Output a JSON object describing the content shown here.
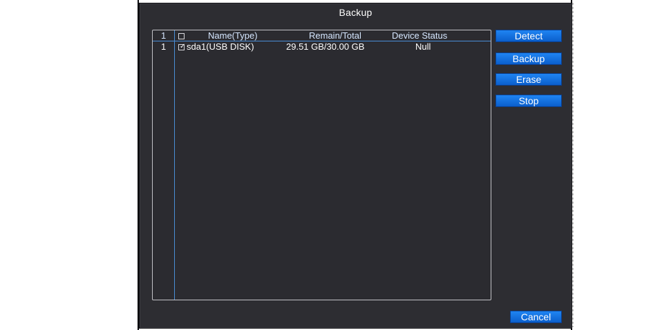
{
  "dialog": {
    "title": "Backup"
  },
  "table": {
    "header": {
      "index": "1",
      "name": "Name(Type)",
      "remain_total": "Remain/Total",
      "device_status": "Device Status"
    },
    "rows": [
      {
        "index": "1",
        "checked": true,
        "name": "sda1(USB DISK)",
        "remain_total": "29.51 GB/30.00 GB",
        "device_status": "Null"
      }
    ]
  },
  "buttons": {
    "detect": "Detect",
    "backup": "Backup",
    "erase": "Erase",
    "stop": "Stop",
    "cancel": "Cancel"
  },
  "colors": {
    "dialog_bg": "#2d2d32",
    "grid_line": "#4a8fd8",
    "button": "#0b5fcc",
    "text": "#ffffff"
  }
}
